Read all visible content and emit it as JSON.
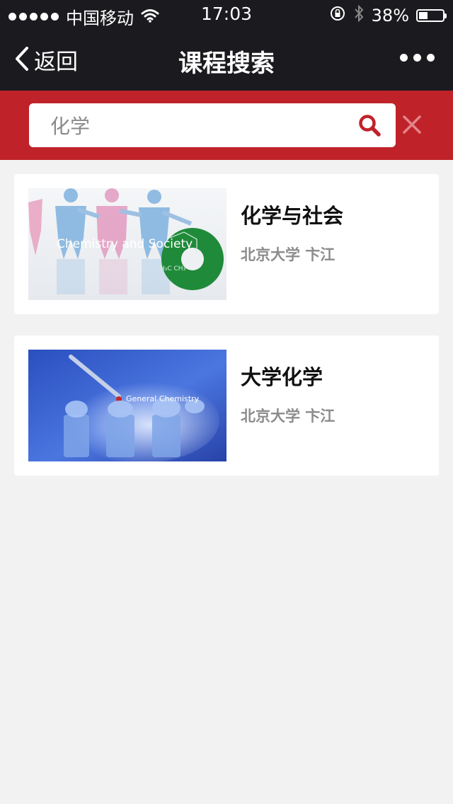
{
  "status_bar": {
    "carrier": "中国移动",
    "time": "17:03",
    "battery": "38%",
    "battery_level": 0.38
  },
  "nav": {
    "back_label": "返回",
    "title": "课程搜索"
  },
  "search": {
    "value": "化学"
  },
  "courses": [
    {
      "title": "化学与社会",
      "meta": "北京大学 卞江",
      "thumb_caption": "Chemistry and Society",
      "thumb_formula": "H₃C   CH₃"
    },
    {
      "title": "大学化学",
      "meta": "北京大学 卞江",
      "thumb_caption": "General Chemistry"
    }
  ],
  "colors": {
    "nav_bg": "#1b1b1f",
    "accent_red": "#c0222a",
    "page_bg": "#f2f2f2"
  }
}
